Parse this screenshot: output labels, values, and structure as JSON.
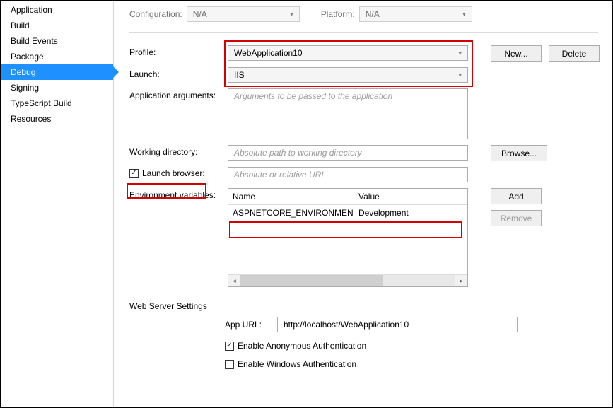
{
  "sidebar": {
    "items": [
      {
        "label": "Application",
        "selected": false
      },
      {
        "label": "Build",
        "selected": false
      },
      {
        "label": "Build Events",
        "selected": false
      },
      {
        "label": "Package",
        "selected": false
      },
      {
        "label": "Debug",
        "selected": true
      },
      {
        "label": "Signing",
        "selected": false
      },
      {
        "label": "TypeScript Build",
        "selected": false
      },
      {
        "label": "Resources",
        "selected": false
      }
    ]
  },
  "configRow": {
    "configurationLabel": "Configuration:",
    "configurationValue": "N/A",
    "platformLabel": "Platform:",
    "platformValue": "N/A"
  },
  "labels": {
    "profile": "Profile:",
    "launch": "Launch:",
    "appArgs": "Application arguments:",
    "workingDir": "Working directory:",
    "launchBrowser": "Launch browser:",
    "envVars": "Environment variables:",
    "webServer": "Web Server Settings",
    "appUrl": "App URL:",
    "anonAuth": "Enable Anonymous Authentication",
    "winAuth": "Enable Windows Authentication"
  },
  "values": {
    "profile": "WebApplication10",
    "launch": "IIS",
    "appArgsPlaceholder": "Arguments to be passed to the application",
    "workingDirPlaceholder": "Absolute path to working directory",
    "launchBrowserPlaceholder": "Absolute or relative URL",
    "appUrl": "http://localhost/WebApplication10",
    "launchBrowserChecked": true,
    "anonAuthChecked": true,
    "winAuthChecked": false
  },
  "envvars": {
    "headers": {
      "name": "Name",
      "value": "Value"
    },
    "rows": [
      {
        "name": "ASPNETCORE_ENVIRONMENT",
        "value": "Development"
      }
    ]
  },
  "buttons": {
    "new": "New...",
    "delete": "Delete",
    "browse": "Browse...",
    "add": "Add",
    "remove": "Remove"
  }
}
